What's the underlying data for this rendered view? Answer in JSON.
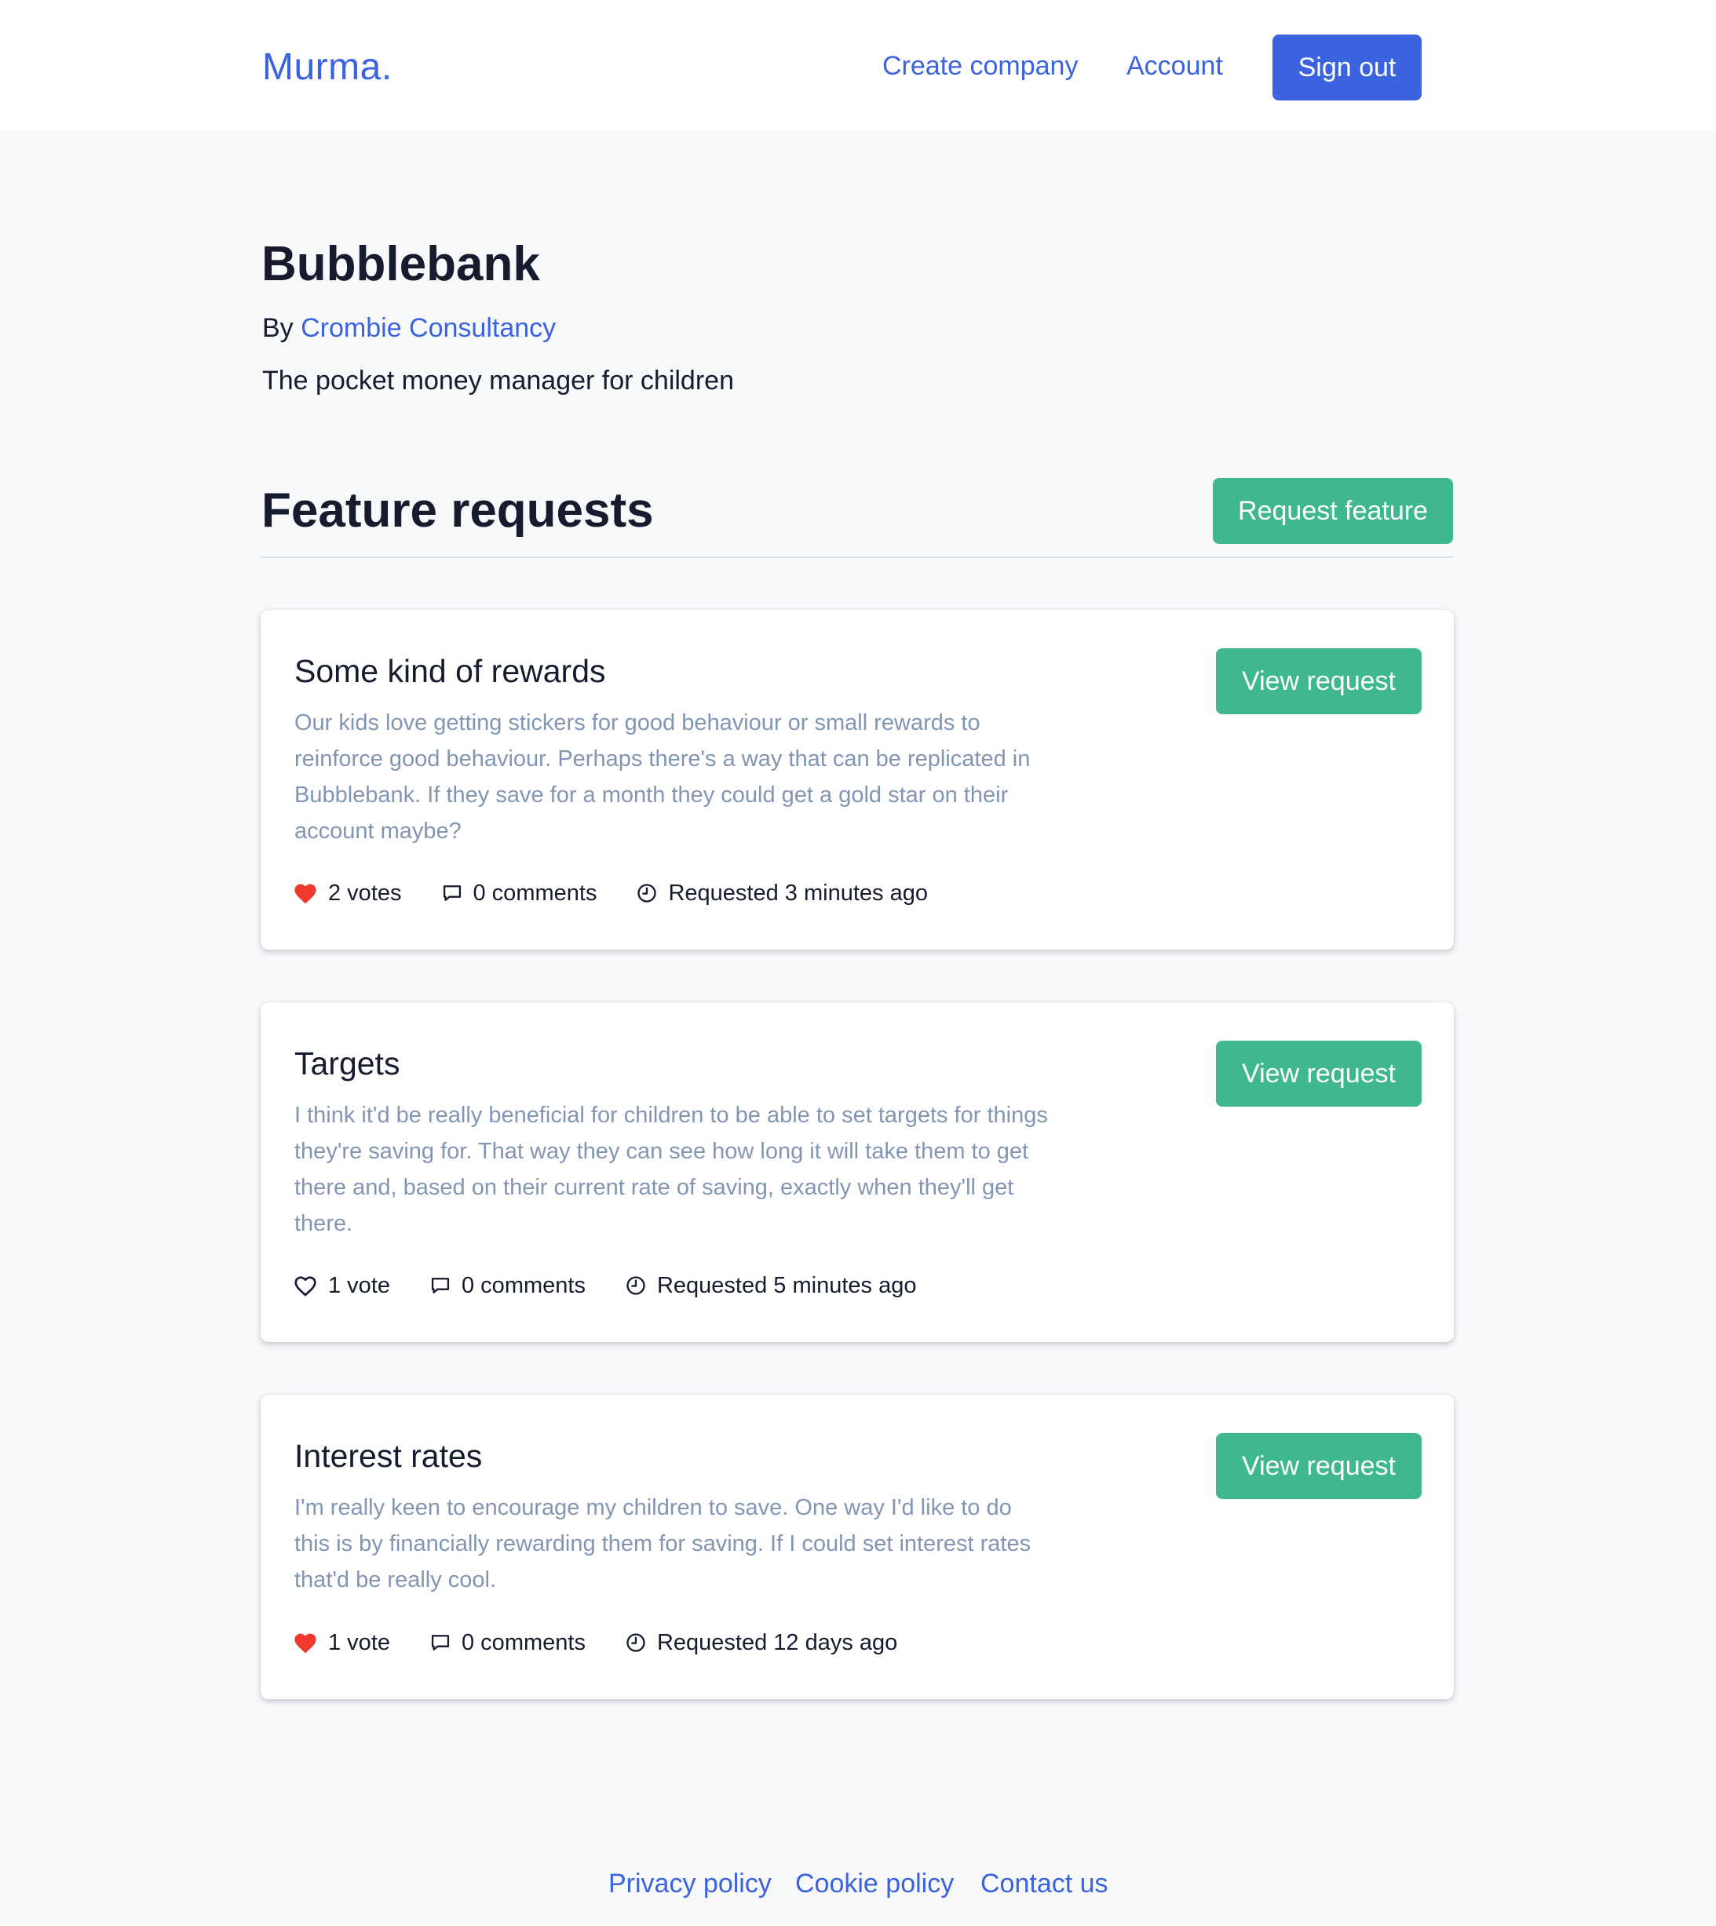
{
  "header": {
    "brand": "Murma.",
    "nav": {
      "create_company": "Create company",
      "account": "Account",
      "sign_out": "Sign out"
    }
  },
  "company": {
    "name": "Bubblebank",
    "by_prefix": "By ",
    "owner": "Crombie Consultancy",
    "tagline": "The pocket money manager for children"
  },
  "section": {
    "title": "Feature requests",
    "request_button": "Request feature"
  },
  "colors": {
    "primary": "#3b63e0",
    "success": "#40b88e",
    "heart_active": "#f0392e",
    "muted_text": "#8296b4",
    "page_bg": "#f8f9fb"
  },
  "requests": [
    {
      "title": "Some kind of rewards",
      "description": "Our kids love getting stickers for good behaviour or small rewards to reinforce good behaviour. Perhaps there's a way that can be replicated in Bubblebank. If they save for a month they could get a gold star on their account maybe?",
      "votes": "2 votes",
      "voted": true,
      "comments": "0 comments",
      "requested": "Requested 3 minutes ago",
      "view_button": "View request"
    },
    {
      "title": "Targets",
      "description": "I think it'd be really beneficial for children to be able to set targets for things they're saving for. That way they can see how long it will take them to get there and, based on their current rate of saving, exactly when they'll get there.",
      "votes": "1 vote",
      "voted": false,
      "comments": "0 comments",
      "requested": "Requested 5 minutes ago",
      "view_button": "View request"
    },
    {
      "title": "Interest rates",
      "description": "I'm really keen to encourage my children to save. One way I'd like to do this is by financially rewarding them for saving. If I could set interest rates that'd be really cool.",
      "votes": "1 vote",
      "voted": true,
      "comments": "0 comments",
      "requested": "Requested 12 days ago",
      "view_button": "View request"
    }
  ],
  "footer": {
    "privacy": "Privacy policy",
    "cookie": "Cookie policy",
    "contact": "Contact us"
  }
}
